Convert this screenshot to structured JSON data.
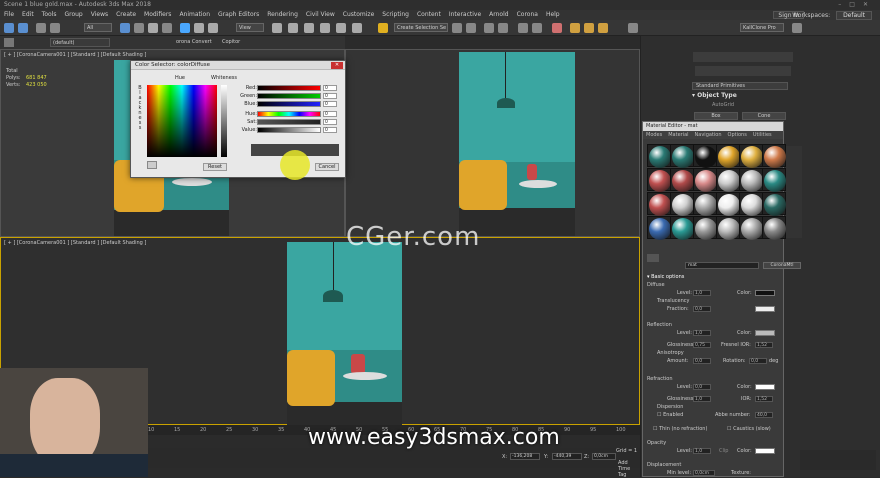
{
  "window": {
    "title": "Scene 1 blue gold.max - Autodesk 3ds Max 2018"
  },
  "menu": [
    "File",
    "Edit",
    "Tools",
    "Group",
    "Views",
    "Create",
    "Modifiers",
    "Animation",
    "Graph Editors",
    "Rendering",
    "Civil View",
    "Customize",
    "Scripting",
    "Content",
    "Interactive",
    "Arnold",
    "Corona",
    "Help"
  ],
  "account": {
    "sign_in": "Sign In",
    "workspaces_label": "Workspaces:",
    "workspace_value": "Default"
  },
  "toolbar": {
    "all_filter": "All",
    "view": "View",
    "create_selection_set": "Create Selection Se",
    "layer": "(default)",
    "corona_converter": "orona Convert",
    "copitor": "Copitor",
    "render_preset": "KallClone Pro"
  },
  "viewports": {
    "top_left": {
      "label": "[ + ] [CoronaCamera001 ] [Standard ] [Default Shading ]"
    },
    "bottom": {
      "label": "[ + ] [CoronaCamera001 ] [Standard ] [Default Shading ]"
    }
  },
  "stats": {
    "total_label": "Total",
    "polys_label": "Polys:",
    "polys_value": "681 847",
    "verts_label": "Verts:",
    "verts_value": "423 050"
  },
  "color_selector": {
    "title": "Color Selector: colorDiffuse",
    "hue_label": "Hue",
    "whiteness_label": "Whiteness",
    "blackness_label": "Blackness",
    "channels": [
      {
        "label": "Red:",
        "value": "0"
      },
      {
        "label": "Green:",
        "value": "0"
      },
      {
        "label": "Blue:",
        "value": "0"
      },
      {
        "label": "Hue:",
        "value": "0"
      },
      {
        "label": "Sat:",
        "value": "0"
      },
      {
        "label": "Value:",
        "value": "0"
      }
    ],
    "reset_label": "Reset",
    "cancel_label": "Cancel"
  },
  "command_panel": {
    "primitives": "Standard Primitives",
    "object_type": "Object Type",
    "autogrid": "AutoGrid",
    "buttons": [
      "Box",
      "Cone",
      "Sphere",
      "GeoSphere"
    ]
  },
  "material_editor": {
    "title": "Material Editor - mat",
    "menu": [
      "Modes",
      "Material",
      "Navigation",
      "Options",
      "Utilities"
    ],
    "material_name": "mat",
    "material_type": "CoronaMtl",
    "basic_options": "Basic options",
    "diffuse": {
      "title": "Diffuse",
      "level_label": "Level:",
      "level_value": "1,0",
      "color_label": "Color:",
      "translucency": "Translucency",
      "fraction_label": "Fraction:",
      "fraction_value": "0,0"
    },
    "reflection": {
      "title": "Reflection",
      "level_label": "Level:",
      "level_value": "1,0",
      "color_label": "Color:",
      "glossiness_label": "Glossiness:",
      "glossiness_value": "0,75",
      "fresnel_label": "Fresnel IOR:",
      "fresnel_value": "1,52",
      "anisotropy": "Anisotropy",
      "amount_label": "Amount:",
      "amount_value": "0,0",
      "rotation_label": "Rotation:",
      "rotation_value": "0,0",
      "deg": "deg"
    },
    "refraction": {
      "title": "Refraction",
      "level_label": "Level:",
      "level_value": "0,0",
      "color_label": "Color:",
      "glossiness_label": "Glossiness:",
      "glossiness_value": "1,0",
      "ior_label": "IOR:",
      "ior_value": "1,52",
      "dispersion": "Dispersion",
      "enabled": "Enabled",
      "abbe_label": "Abbe number:",
      "abbe_value": "40,0",
      "thin_label": "Thin (no refraction)",
      "caustics_label": "Caustics (slow)"
    },
    "opacity": {
      "title": "Opacity",
      "level_label": "Level:",
      "level_value": "1,0",
      "clip_label": "Clip",
      "color_label": "Color:"
    },
    "displacement": {
      "title": "Displacement",
      "min_label": "Min level:",
      "min_value": "0,0cm",
      "texture_label": "Texture:"
    }
  },
  "timeline": {
    "ticks": [
      "10",
      "15",
      "20",
      "25",
      "30",
      "35",
      "40",
      "45",
      "50",
      "55",
      "60",
      "65",
      "70",
      "75",
      "80",
      "85",
      "90",
      "95",
      "100"
    ]
  },
  "status": {
    "x_label": "X:",
    "x_value": "-136,208",
    "y_label": "Y:",
    "y_value": "-440,39",
    "z_label": "Z:",
    "z_value": "0,0cm",
    "grid_label": "Grid = 1",
    "add_time_tag": "Add Time Tag"
  },
  "watermarks": {
    "cgpeers": "CGer.com",
    "url": "www.easy3dsmax.com"
  },
  "colors": {
    "teal_wall": "#3aa6a1",
    "sofa_yellow": "#e0a52a",
    "selection_yellow": "#c9a200",
    "cursor_highlight": "#e6e628"
  }
}
